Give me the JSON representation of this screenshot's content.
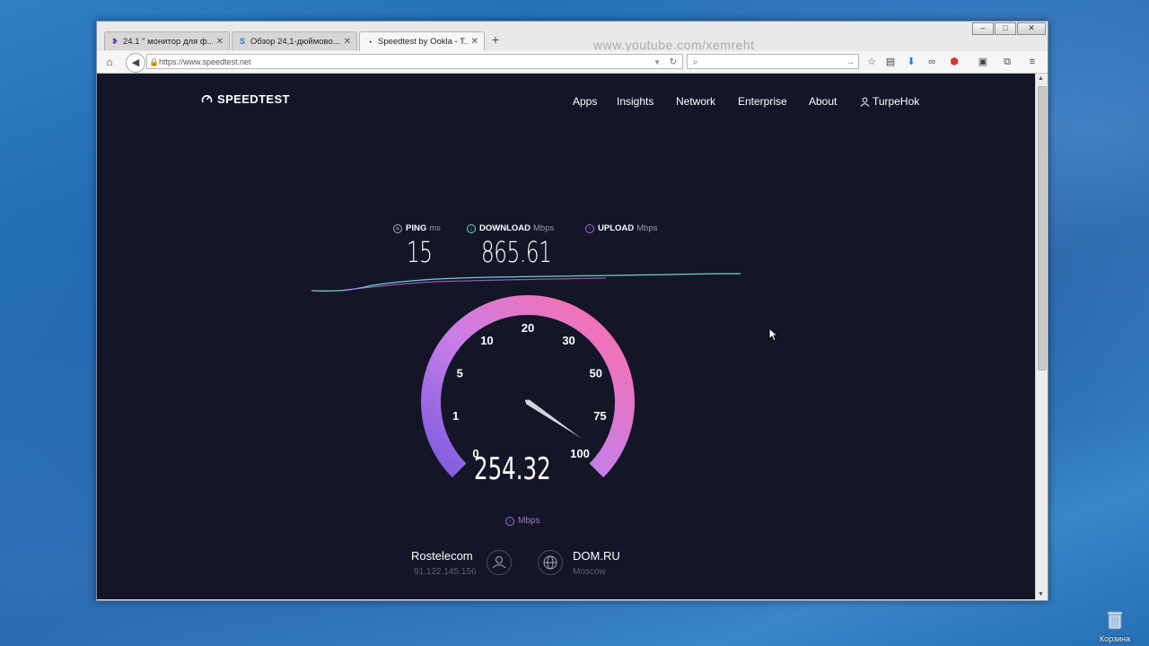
{
  "browser": {
    "tabs": [
      {
        "title": "24.1 \" монитор для ф...",
        "icon": "pocket-icon"
      },
      {
        "title": "Обзор 24,1-дюймово...",
        "icon": "site-s-icon"
      },
      {
        "title": "Speedtest by Ookla - T...",
        "icon": "speedtest-icon"
      }
    ],
    "new_tab_label": "+",
    "watermark": "www.youtube.com/xemreht",
    "url": "https://www.speedtest.net",
    "search_placeholder": ""
  },
  "site": {
    "logo": "SPEEDTEST",
    "nav": [
      "Apps",
      "Insights",
      "Network",
      "Enterprise",
      "About"
    ],
    "user": "TurpeHok"
  },
  "metrics": {
    "ping_label": "PING",
    "ping_unit": "ms",
    "ping_value": "15",
    "download_label": "DOWNLOAD",
    "download_unit": "Mbps",
    "download_value": "865.61",
    "upload_label": "UPLOAD",
    "upload_unit": "Mbps",
    "upload_value": ""
  },
  "gauge": {
    "current_value": "254.32",
    "unit": "Mbps",
    "ticks": [
      "0",
      "1",
      "5",
      "10",
      "20",
      "30",
      "50",
      "75",
      "100"
    ],
    "needle_fraction": 0.96
  },
  "connection": {
    "isp": "Rostelecom",
    "ip": "91.122.145.156",
    "server": "DOM.RU",
    "location": "Moscow"
  },
  "desktop": {
    "recycle_bin_label": "Корзина"
  },
  "colors": {
    "page_bg": "#141526",
    "download_accent": "#6dd4d0",
    "upload_accent": "#b46ae0",
    "gauge_start": "#8a63e6",
    "gauge_end": "#ff6fb0"
  }
}
